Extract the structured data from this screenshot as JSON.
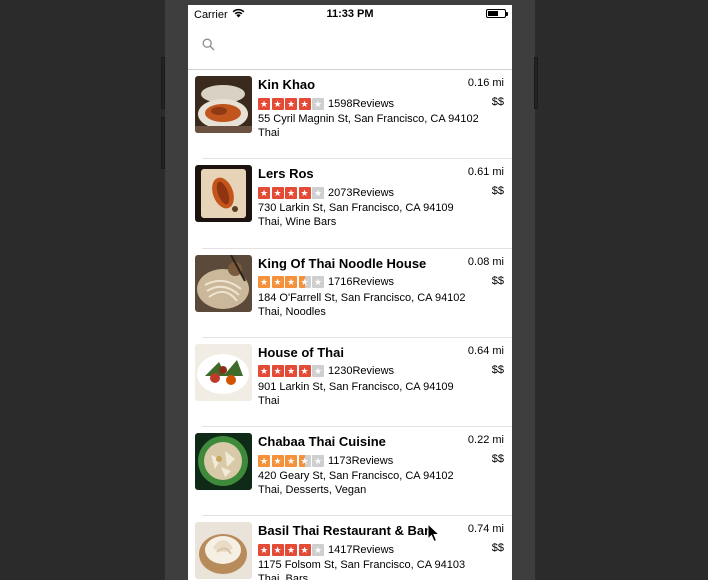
{
  "status_bar": {
    "carrier": "Carrier",
    "time": "11:33 PM",
    "battery_level": 0.6
  },
  "search": {
    "placeholder": "",
    "value": ""
  },
  "colors": {
    "star_red": "#e44b36",
    "star_orange": "#f5903b",
    "star_empty": "#cfcfcf"
  },
  "restaurants": [
    {
      "name": "Kin Khao",
      "distance": "0.16 mi",
      "price": "$$",
      "rating": 4,
      "star_color": "red",
      "reviews": "1598Reviews",
      "address": "55 Cyril Magnin St, San Francisco, CA 94102",
      "categories": "Thai"
    },
    {
      "name": "Lers Ros",
      "distance": "0.61 mi",
      "price": "$$",
      "rating": 4,
      "star_color": "red",
      "reviews": "2073Reviews",
      "address": "730 Larkin St, San Francisco, CA 94109",
      "categories": "Thai, Wine Bars"
    },
    {
      "name": "King Of Thai Noodle House",
      "distance": "0.08 mi",
      "price": "$$",
      "rating": 3.5,
      "star_color": "orange",
      "reviews": "1716Reviews",
      "address": "184 O'Farrell St, San Francisco, CA 94102",
      "categories": "Thai, Noodles"
    },
    {
      "name": "House of Thai",
      "distance": "0.64 mi",
      "price": "$$",
      "rating": 4,
      "star_color": "red",
      "reviews": "1230Reviews",
      "address": "901 Larkin St, San Francisco, CA 94109",
      "categories": "Thai"
    },
    {
      "name": "Chabaa Thai Cuisine",
      "distance": "0.22 mi",
      "price": "$$",
      "rating": 3.5,
      "star_color": "orange",
      "reviews": "1173Reviews",
      "address": "420 Geary St, San Francisco, CA 94102",
      "categories": "Thai, Desserts, Vegan"
    },
    {
      "name": "Basil Thai Restaurant & Bar",
      "distance": "0.74 mi",
      "price": "$$",
      "rating": 4,
      "star_color": "red",
      "reviews": "1417Reviews",
      "address": "1175 Folsom St, San Francisco, CA 94103",
      "categories": "Thai, Bars"
    }
  ]
}
